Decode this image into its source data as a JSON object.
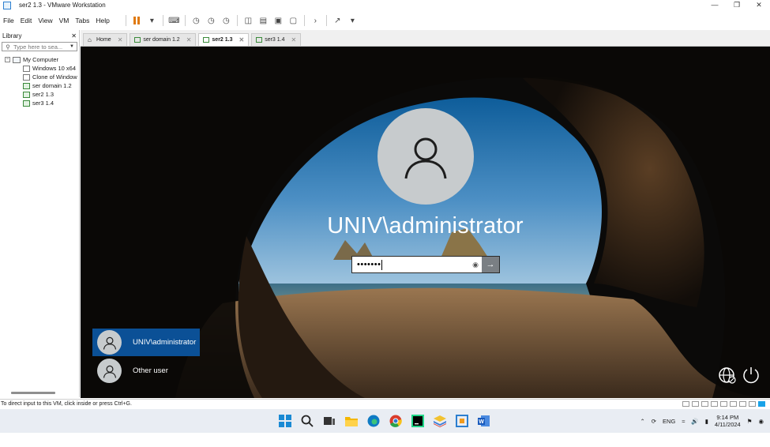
{
  "window": {
    "title": "ser2 1.3 - VMware Workstation"
  },
  "menu": [
    "File",
    "Edit",
    "View",
    "VM",
    "Tabs",
    "Help"
  ],
  "library": {
    "title": "Library",
    "search_placeholder": "Type here to sea...",
    "root": "My Computer",
    "items": [
      "Windows 10 x64",
      "Clone of Window",
      "ser domain 1.2",
      "ser2 1.3",
      "ser3 1.4"
    ]
  },
  "tabs": [
    "Home",
    "ser domain 1.2",
    "ser2 1.3",
    "ser3 1.4"
  ],
  "active_tab": "ser2 1.3",
  "login": {
    "username": "UNIV\\administrator",
    "password_mask": "•••••••"
  },
  "users": [
    "UNIV\\administrator",
    "Other user"
  ],
  "statusbar": {
    "message": "To direct input to this VM, click inside or press Ctrl+G."
  },
  "taskbar": {
    "apps": [
      "windows-start-icon",
      "search-icon",
      "task-view-icon",
      "file-explorer-icon",
      "edge-icon",
      "chrome-icon",
      "pycharm-icon",
      "stack-app-icon",
      "vmware-icon",
      "word-icon"
    ],
    "lang": "ENG",
    "time": "9:14 PM",
    "date": "4/11/2024"
  },
  "colors": {
    "accent": "#0b5096",
    "taskbar": "#e9edf3",
    "vmware_orange": "#e07a10"
  }
}
